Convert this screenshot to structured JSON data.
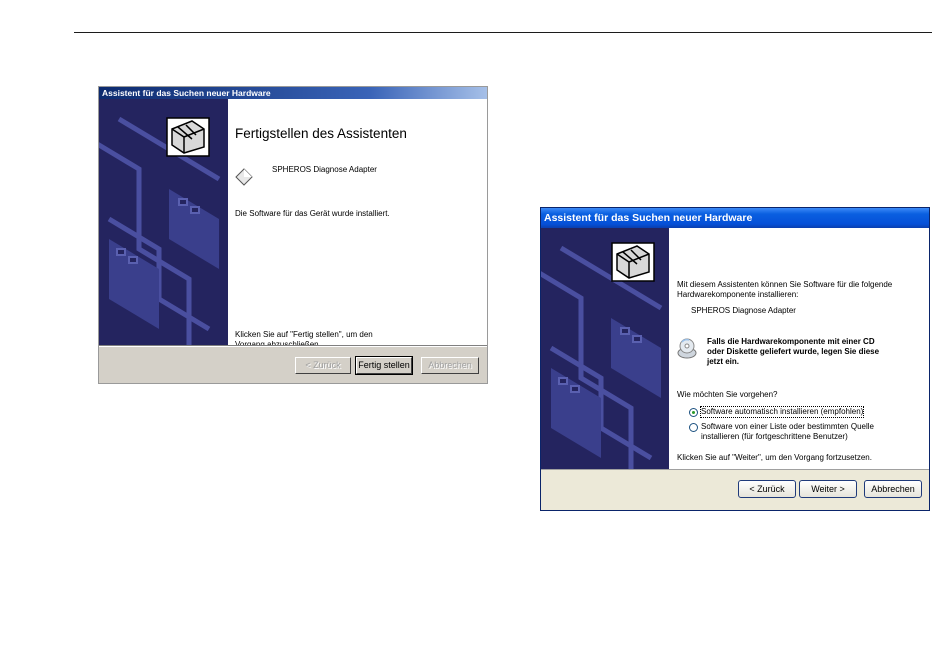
{
  "wizard_complete": {
    "title": "Assistent für das Suchen neuer Hardware",
    "heading": "Fertigstellen des Assistenten",
    "device_name": "SPHEROS Diagnose Adapter",
    "status_text": "Die Software für das Gerät wurde installiert.",
    "instruction_line1": "Klicken Sie auf \"Fertig stellen\", um den",
    "instruction_line2": "Vorgang abzuschließen.",
    "back_label": "< Zurück",
    "finish_label": "Fertig stellen",
    "cancel_label": "Abbrechen"
  },
  "wizard_start": {
    "title": "Assistent für das Suchen neuer Hardware",
    "intro_line1": "Mit diesem Assistenten können Sie Software für die folgende",
    "intro_line2": "Hardwarekomponente installieren:",
    "device_name": "SPHEROS Diagnose Adapter",
    "cd_hint_line1": "Falls die Hardwarekomponente mit einer CD",
    "cd_hint_line2": "oder Diskette geliefert wurde, legen Sie diese",
    "cd_hint_line3": "jetzt ein.",
    "question": "Wie möchten Sie vorgehen?",
    "option_auto": "Software automatisch installieren (empfohlen)",
    "option_manual_line1": "Software von einer Liste oder bestimmten Quelle",
    "option_manual_line2": "installieren (für fortgeschrittene Benutzer)",
    "selected_option": "auto",
    "continue_text": "Klicken Sie auf \"Weiter\", um den Vorgang fortzusetzen.",
    "back_label": "< Zurück",
    "next_label": "Weiter >",
    "cancel_label": "Abbrechen"
  },
  "icons": {
    "side_banner": "hardware-wizard-banner",
    "hardware": "hardware-box-icon",
    "device": "device-diamond-icon",
    "cd": "cd-icon"
  },
  "colors": {
    "banner": "#24245f",
    "classic_titlebar": "#0c2a6e",
    "xp_titlebar": "#0550d8"
  }
}
